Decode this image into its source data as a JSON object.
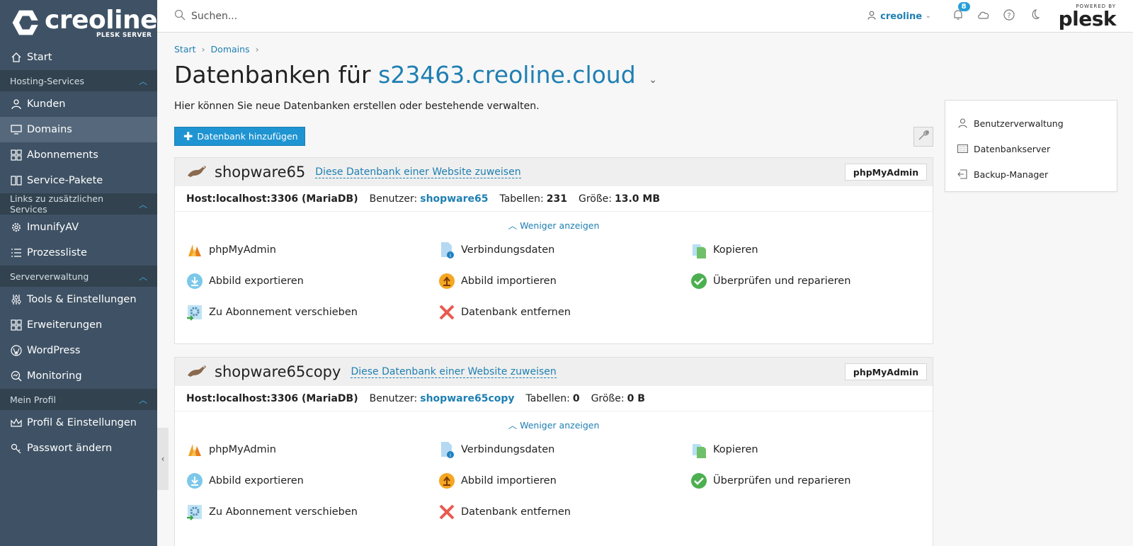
{
  "brand": {
    "name": "creoline",
    "subtitle": "PLESK SERVER"
  },
  "search": {
    "placeholder": "Suchen..."
  },
  "topbar": {
    "user": "creoline",
    "notifications_count": "8",
    "powered_by": "POWERED BY",
    "plesk": "plesk"
  },
  "sidebar": {
    "start": "Start",
    "group_hosting": "Hosting-Services",
    "kunden": "Kunden",
    "domains": "Domains",
    "abonnements": "Abonnements",
    "service_pakete": "Service-Pakete",
    "group_links": "Links zu zusätzlichen Services",
    "imunify": "ImunifyAV",
    "prozessliste": "Prozessliste",
    "group_server": "Serververwaltung",
    "tools": "Tools & Einstellungen",
    "erweiterungen": "Erweiterungen",
    "wordpress": "WordPress",
    "monitoring": "Monitoring",
    "group_profil": "Mein Profil",
    "profil": "Profil & Einstellungen",
    "passwort": "Passwort ändern"
  },
  "breadcrumb": {
    "start": "Start",
    "domains": "Domains"
  },
  "page": {
    "title_prefix": "Datenbanken für",
    "title_domain": "s23463.creoline.cloud",
    "description": "Hier können Sie neue Datenbanken erstellen oder bestehende verwalten.",
    "add_button": "Datenbank hinzufügen"
  },
  "side_panel": {
    "user_mgmt": "Benutzerverwaltung",
    "db_server": "Datenbankserver",
    "backup": "Backup-Manager"
  },
  "databases": [
    {
      "name": "shopware65",
      "assign": "Diese Datenbank einer Website zuweisen",
      "pma_button": "phpMyAdmin",
      "host": "Host:localhost:3306 (MariaDB)",
      "user_label": "Benutzer:",
      "user": "shopware65",
      "tables_label": "Tabellen:",
      "tables": "231",
      "size_label": "Größe:",
      "size": "13.0 MB",
      "less": "Weniger anzeigen",
      "actions": {
        "pma": "phpMyAdmin",
        "conn": "Verbindungsdaten",
        "copy": "Kopieren",
        "export": "Abbild exportieren",
        "import": "Abbild importieren",
        "check": "Überprüfen und reparieren",
        "move": "Zu Abonnement verschieben",
        "remove": "Datenbank entfernen"
      }
    },
    {
      "name": "shopware65copy",
      "assign": "Diese Datenbank einer Website zuweisen",
      "pma_button": "phpMyAdmin",
      "host": "Host:localhost:3306 (MariaDB)",
      "user_label": "Benutzer:",
      "user": "shopware65copy",
      "tables_label": "Tabellen:",
      "tables": "0",
      "size_label": "Größe:",
      "size": "0 B",
      "less": "Weniger anzeigen",
      "actions": {
        "pma": "phpMyAdmin",
        "conn": "Verbindungsdaten",
        "copy": "Kopieren",
        "export": "Abbild exportieren",
        "import": "Abbild importieren",
        "check": "Überprüfen und reparieren",
        "move": "Zu Abonnement verschieben",
        "remove": "Datenbank entfernen"
      }
    }
  ]
}
